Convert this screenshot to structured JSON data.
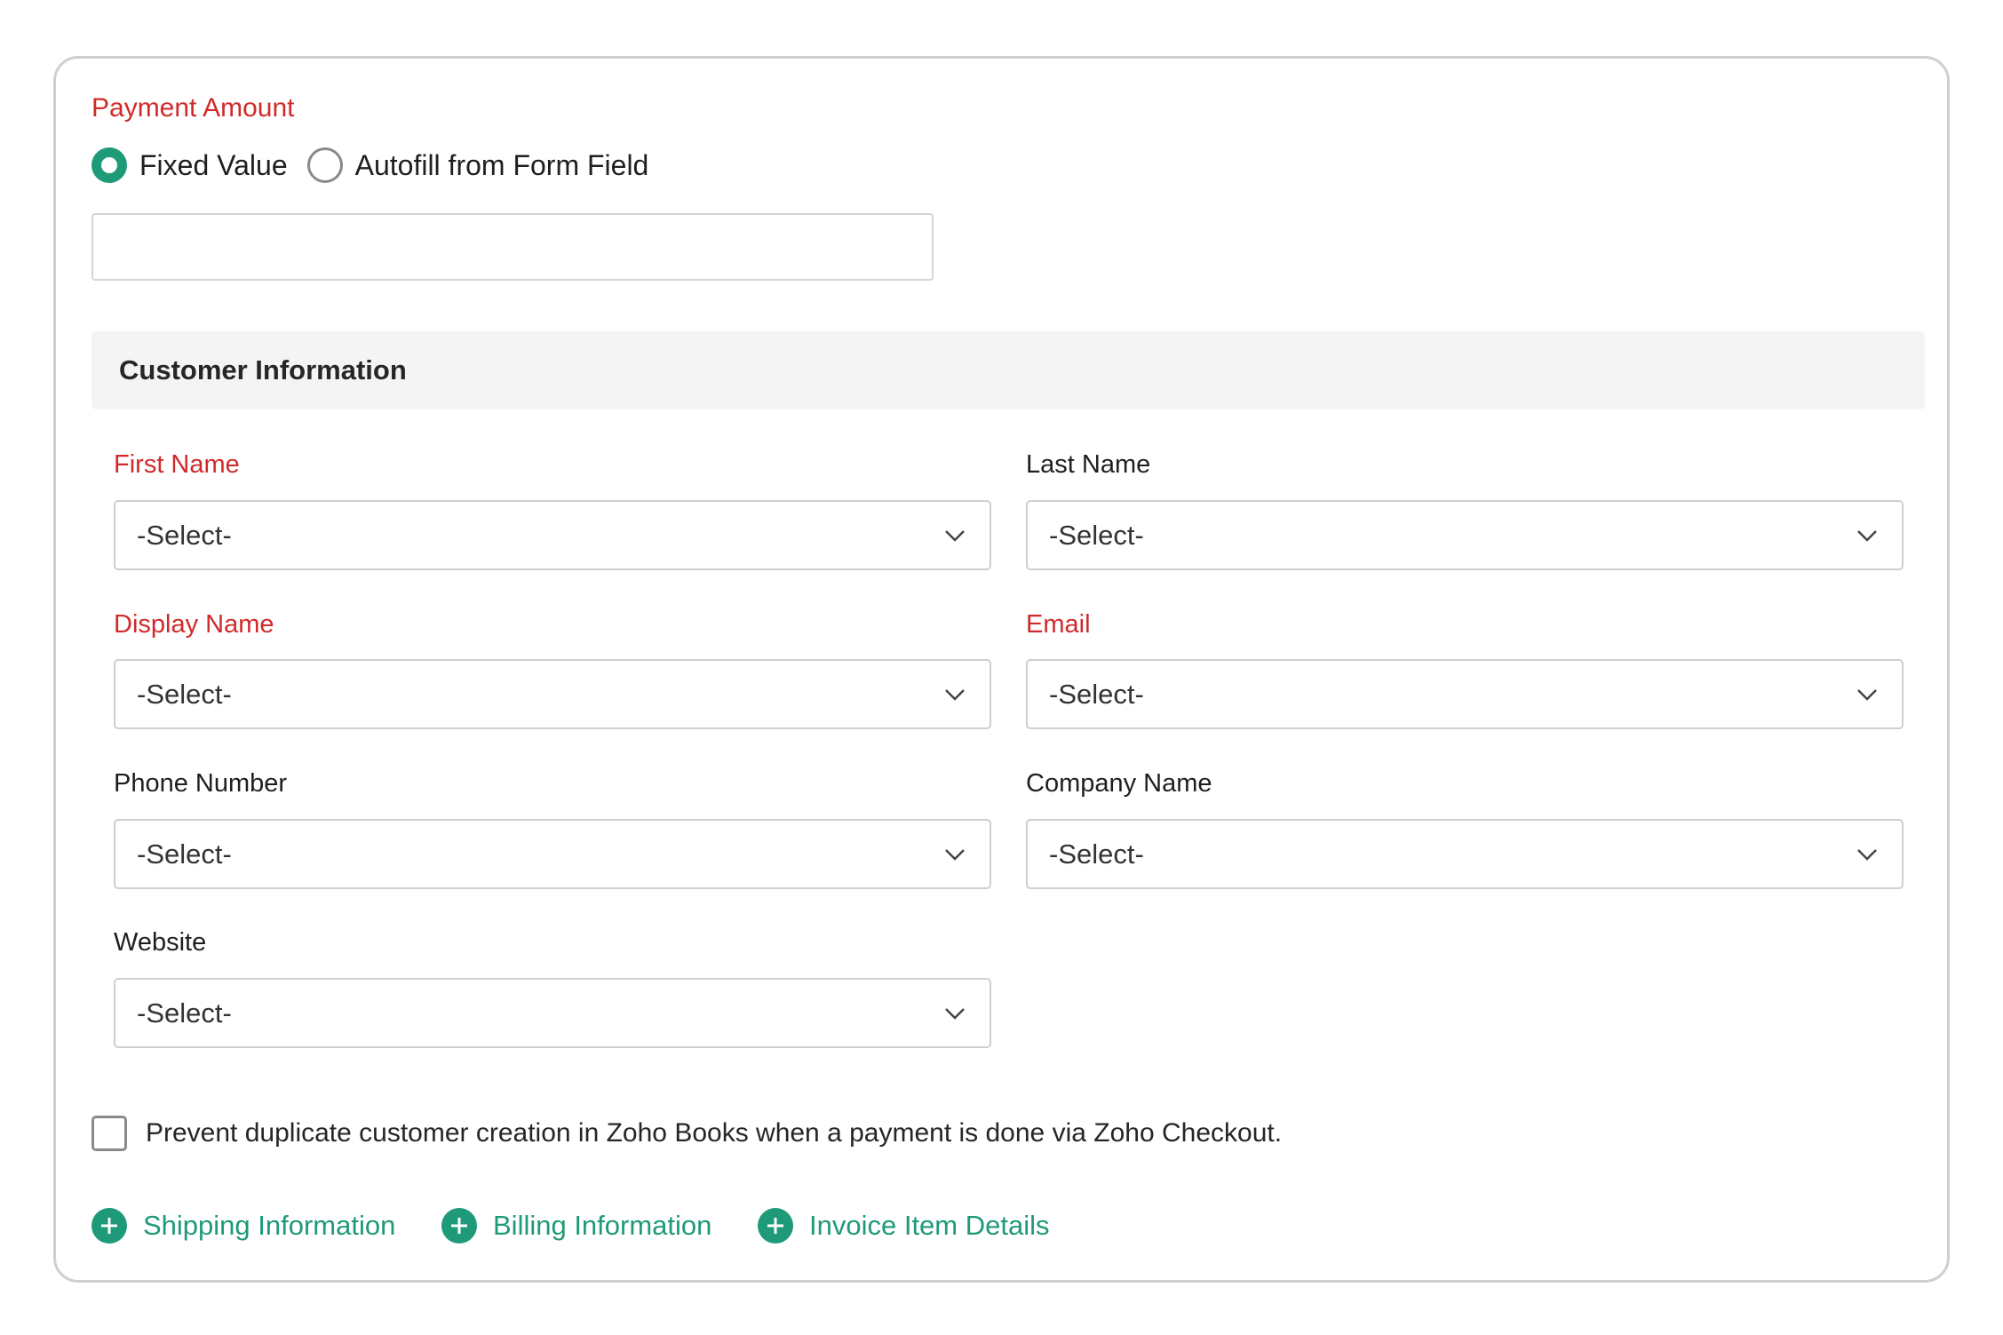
{
  "payment": {
    "label": "Payment Amount",
    "options": [
      {
        "label": "Fixed Value",
        "selected": true
      },
      {
        "label": "Autofill from Form Field",
        "selected": false
      }
    ],
    "amount_value": ""
  },
  "customer_section": {
    "title": "Customer Information",
    "fields": [
      {
        "label": "First Name",
        "required": true,
        "value": "-Select-"
      },
      {
        "label": "Last Name",
        "required": false,
        "value": "-Select-"
      },
      {
        "label": "Display Name",
        "required": true,
        "value": "-Select-"
      },
      {
        "label": "Email",
        "required": true,
        "value": "-Select-"
      },
      {
        "label": "Phone Number",
        "required": false,
        "value": "-Select-"
      },
      {
        "label": "Company Name",
        "required": false,
        "value": "-Select-"
      },
      {
        "label": "Website",
        "required": false,
        "value": "-Select-"
      }
    ]
  },
  "duplicate_check": {
    "label": "Prevent duplicate customer creation in Zoho Books when a payment is done via Zoho Checkout.",
    "checked": false
  },
  "add_links": [
    {
      "label": "Shipping Information",
      "icon": "plus-circle-icon"
    },
    {
      "label": "Billing Information",
      "icon": "plus-circle-icon"
    },
    {
      "label": "Invoice Item Details",
      "icon": "plus-circle-icon"
    }
  ],
  "colors": {
    "accent": "#1f9a79",
    "required": "#d12a2a",
    "section_bg": "#f4f4f4",
    "border": "#cfcfcf"
  }
}
